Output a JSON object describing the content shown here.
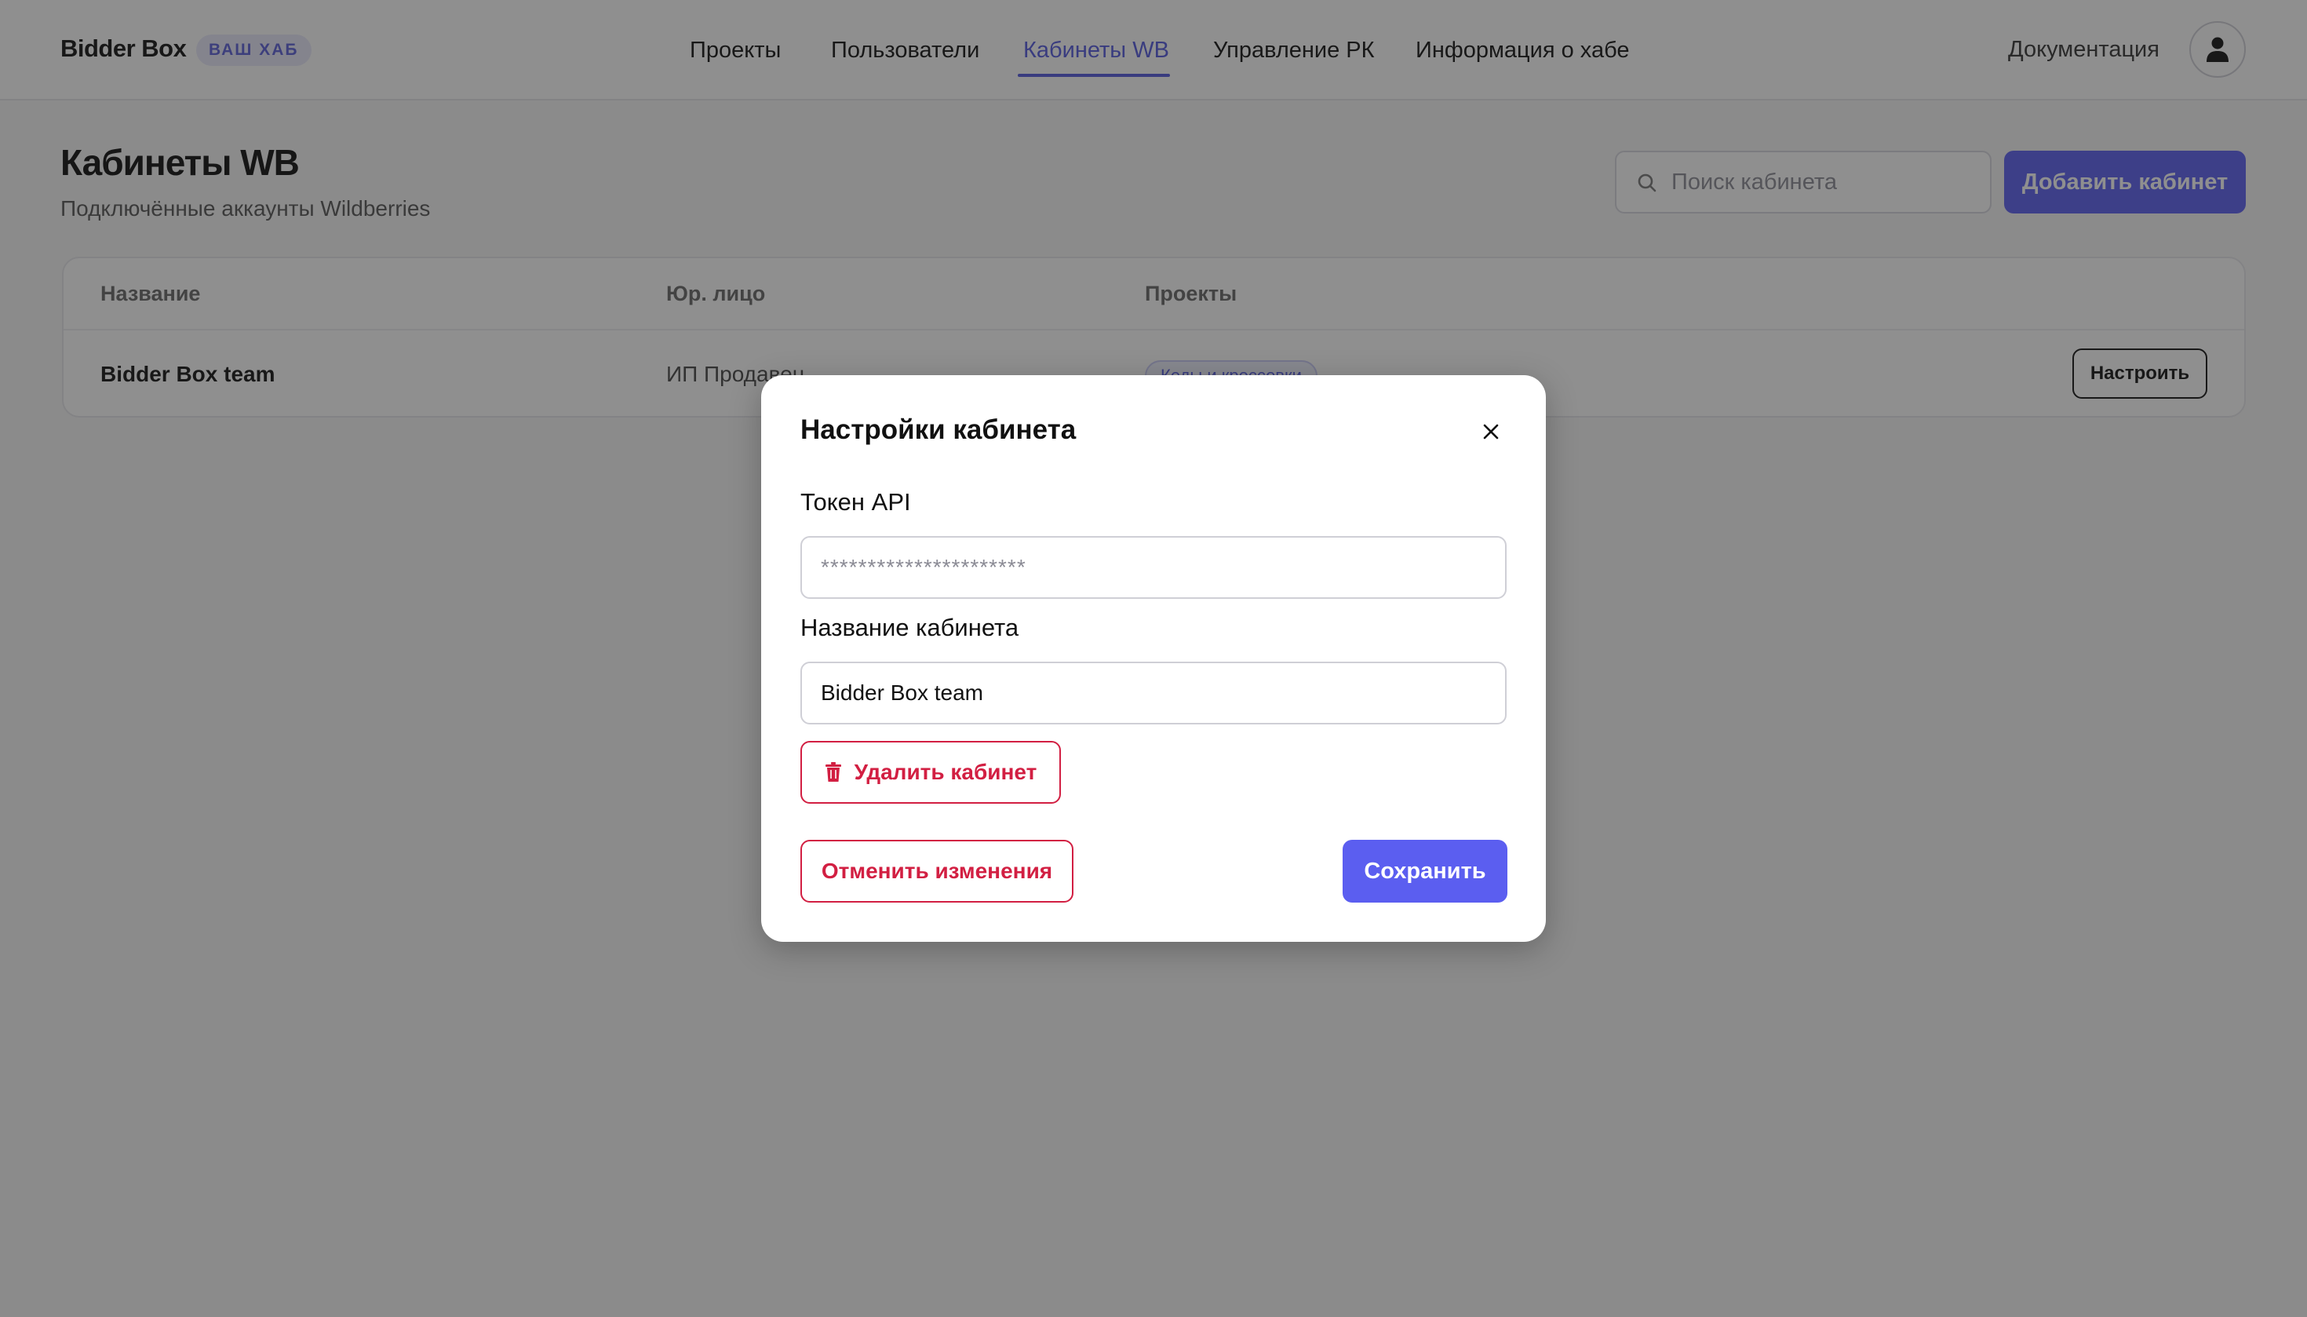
{
  "header": {
    "brand": "Bidder Box",
    "hub_badge": "ВАШ ХАБ",
    "nav": [
      {
        "label": "Проекты",
        "active": false
      },
      {
        "label": "Пользователи",
        "active": false
      },
      {
        "label": "Кабинеты WB",
        "active": true
      },
      {
        "label": "Управление РК",
        "active": false
      },
      {
        "label": "Информация о хабе",
        "active": false
      }
    ],
    "docs_label": "Документация",
    "avatar_icon": "user-icon"
  },
  "page": {
    "title": "Кабинеты WB",
    "subtitle": "Подключённые аккаунты Wildberries",
    "search_placeholder": "Поиск кабинета",
    "add_button": "Добавить кабинет"
  },
  "table": {
    "columns": [
      "Название",
      "Юр. лицо",
      "Проекты"
    ],
    "rows": [
      {
        "name": "Bidder Box team",
        "legal": "ИП Продавец",
        "project_tag": "Кеды и кроссовки",
        "action": "Настроить"
      }
    ]
  },
  "modal": {
    "title": "Настройки кабинета",
    "token_label": "Токен API",
    "token_placeholder": "**********************",
    "name_label": "Название кабинета",
    "name_value": "Bidder Box team",
    "delete_button": "Удалить кабинет",
    "cancel_button": "Отменить изменения",
    "save_button": "Сохранить"
  },
  "colors": {
    "accent": "#5b5ef0",
    "danger": "#d21f42",
    "overlay": "#202020"
  }
}
